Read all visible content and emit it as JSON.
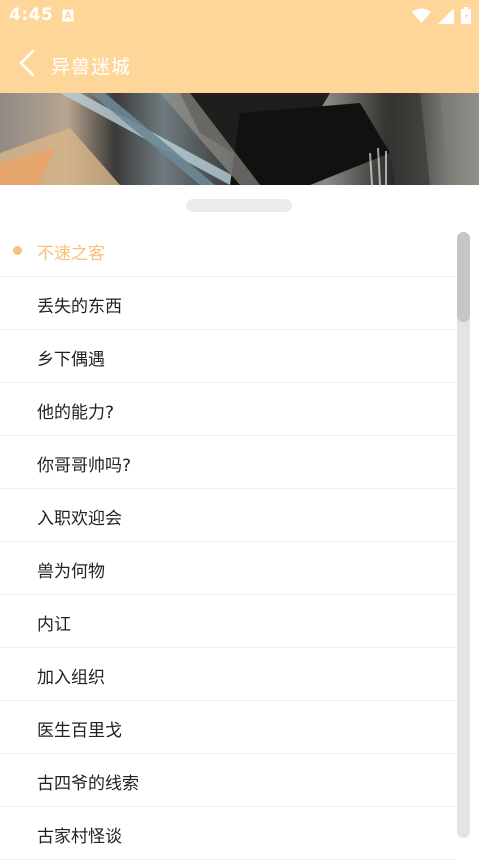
{
  "status_bar": {
    "time": "4:45"
  },
  "toolbar": {
    "title": "异兽迷城"
  },
  "chapters": [
    {
      "title": "不速之客",
      "active": true
    },
    {
      "title": "丢失的东西"
    },
    {
      "title": "乡下偶遇"
    },
    {
      "title": "他的能力?"
    },
    {
      "title": "你哥哥帅吗?"
    },
    {
      "title": "入职欢迎会"
    },
    {
      "title": "兽为何物"
    },
    {
      "title": "内讧"
    },
    {
      "title": "加入组织"
    },
    {
      "title": "医生百里戈"
    },
    {
      "title": "古四爷的线索"
    },
    {
      "title": "古家村怪谈"
    }
  ],
  "colors": {
    "header": "#ffd699",
    "accent": "#f6c27d"
  }
}
